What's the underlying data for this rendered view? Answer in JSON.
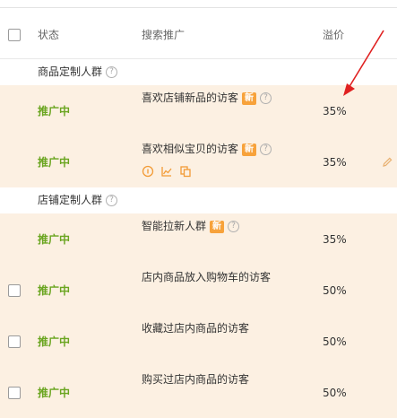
{
  "header": {
    "status_label": "状态",
    "search_label": "搜索推广",
    "premium_label": "溢价"
  },
  "groups": [
    {
      "title": "商品定制人群",
      "rows": [
        {
          "status": "推广中",
          "name": "喜欢店铺新品的访客",
          "badge": "新",
          "premium": "35%"
        },
        {
          "status": "推广中",
          "name": "喜欢相似宝贝的访客",
          "badge": "新",
          "premium": "35%"
        }
      ]
    },
    {
      "title": "店铺定制人群",
      "rows": [
        {
          "status": "推广中",
          "name": "智能拉新人群",
          "badge": "新",
          "premium": "35%"
        },
        {
          "status": "推广中",
          "name": "店内商品放入购物车的访客",
          "premium": "50%"
        },
        {
          "status": "推广中",
          "name": "收藏过店内商品的访客",
          "premium": "50%"
        },
        {
          "status": "推广中",
          "name": "购买过店内商品的访客",
          "premium": "50%"
        }
      ]
    }
  ],
  "colors": {
    "status_green": "#6aa520",
    "highlight_row": "#fcf0e2",
    "new_badge": "#f7a23b",
    "annotation_arrow": "#e02020"
  },
  "icons": [
    "help-icon",
    "info-circle-icon",
    "line-chart-icon",
    "copy-icon",
    "edit-pencil-icon"
  ]
}
